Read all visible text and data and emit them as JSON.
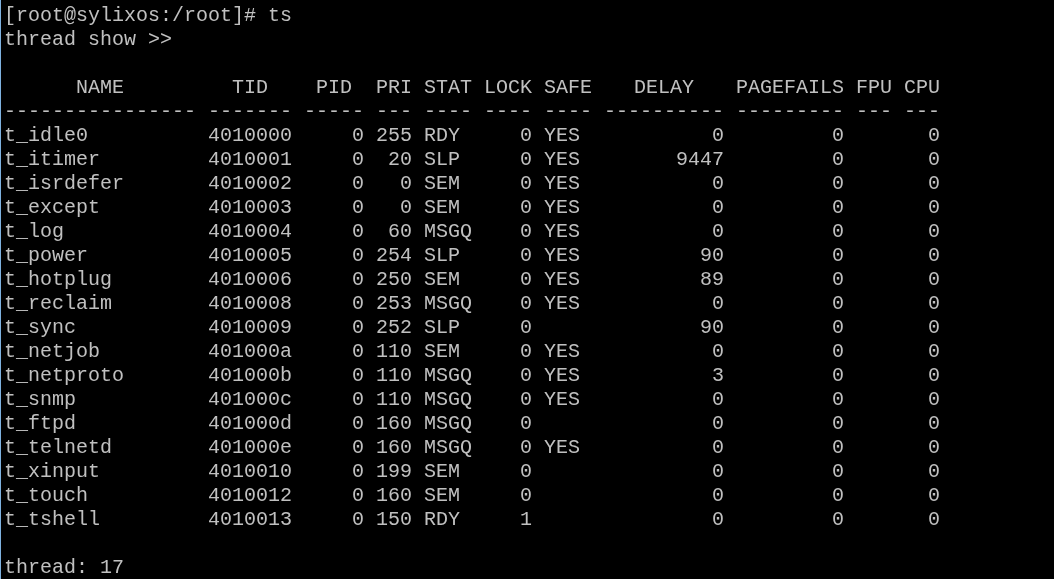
{
  "prompt_line": "[root@sylixos:/root]# ts",
  "subtitle": "thread show >>",
  "table": {
    "columns": [
      {
        "label": "NAME",
        "separator": "----------------"
      },
      {
        "label": "TID",
        "separator": "-------"
      },
      {
        "label": "PID",
        "separator": "-----"
      },
      {
        "label": "PRI",
        "separator": "---"
      },
      {
        "label": "STAT",
        "separator": "----"
      },
      {
        "label": "LOCK",
        "separator": "----"
      },
      {
        "label": "SAFE",
        "separator": "----"
      },
      {
        "label": "DELAY",
        "separator": "----------"
      },
      {
        "label": "PAGEFAILS",
        "separator": "---------"
      },
      {
        "label": "FPU",
        "separator": "---"
      },
      {
        "label": "CPU",
        "separator": "---"
      }
    ],
    "rows": [
      {
        "cells": [
          "t_idle0",
          "4010000",
          "0",
          "255",
          "RDY",
          "0",
          "YES",
          "0",
          "0",
          null,
          "0"
        ]
      },
      {
        "cells": [
          "t_itimer",
          "4010001",
          "0",
          "20",
          "SLP",
          "0",
          "YES",
          "9447",
          "0",
          null,
          "0"
        ]
      },
      {
        "cells": [
          "t_isrdefer",
          "4010002",
          "0",
          "0",
          "SEM",
          "0",
          "YES",
          "0",
          "0",
          null,
          "0"
        ]
      },
      {
        "cells": [
          "t_except",
          "4010003",
          "0",
          "0",
          "SEM",
          "0",
          "YES",
          "0",
          "0",
          null,
          "0"
        ]
      },
      {
        "cells": [
          "t_log",
          "4010004",
          "0",
          "60",
          "MSGQ",
          "0",
          "YES",
          "0",
          "0",
          null,
          "0"
        ]
      },
      {
        "cells": [
          "t_power",
          "4010005",
          "0",
          "254",
          "SLP",
          "0",
          "YES",
          "90",
          "0",
          null,
          "0"
        ]
      },
      {
        "cells": [
          "t_hotplug",
          "4010006",
          "0",
          "250",
          "SEM",
          "0",
          "YES",
          "89",
          "0",
          null,
          "0"
        ]
      },
      {
        "cells": [
          "t_reclaim",
          "4010008",
          "0",
          "253",
          "MSGQ",
          "0",
          "YES",
          "0",
          "0",
          null,
          "0"
        ]
      },
      {
        "cells": [
          "t_sync",
          "4010009",
          "0",
          "252",
          "SLP",
          "0",
          null,
          "90",
          "0",
          null,
          "0"
        ]
      },
      {
        "cells": [
          "t_netjob",
          "401000a",
          "0",
          "110",
          "SEM",
          "0",
          "YES",
          "0",
          "0",
          null,
          "0"
        ]
      },
      {
        "cells": [
          "t_netproto",
          "401000b",
          "0",
          "110",
          "MSGQ",
          "0",
          "YES",
          "3",
          "0",
          null,
          "0"
        ]
      },
      {
        "cells": [
          "t_snmp",
          "401000c",
          "0",
          "110",
          "MSGQ",
          "0",
          "YES",
          "0",
          "0",
          null,
          "0"
        ]
      },
      {
        "cells": [
          "t_ftpd",
          "401000d",
          "0",
          "160",
          "MSGQ",
          "0",
          null,
          "0",
          "0",
          null,
          "0"
        ]
      },
      {
        "cells": [
          "t_telnetd",
          "401000e",
          "0",
          "160",
          "MSGQ",
          "0",
          "YES",
          "0",
          "0",
          null,
          "0"
        ]
      },
      {
        "cells": [
          "t_xinput",
          "4010010",
          "0",
          "199",
          "SEM",
          "0",
          null,
          "0",
          "0",
          null,
          "0"
        ]
      },
      {
        "cells": [
          "t_touch",
          "4010012",
          "0",
          "160",
          "SEM",
          "0",
          null,
          "0",
          "0",
          null,
          "0"
        ]
      },
      {
        "cells": [
          "t_tshell",
          "4010013",
          "0",
          "150",
          "RDY",
          "1",
          null,
          "0",
          "0",
          null,
          "0"
        ]
      }
    ]
  },
  "summary": "thread: 17"
}
